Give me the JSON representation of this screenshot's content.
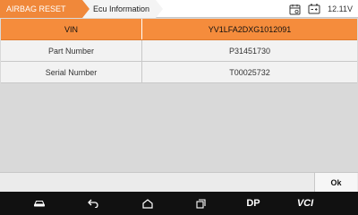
{
  "breadcrumb": {
    "items": [
      "AIRBAG RESET",
      "Ecu Information"
    ]
  },
  "status": {
    "voltage": "12.11V"
  },
  "table": {
    "header": {
      "key": "VIN",
      "value": "YV1LFA2DXG1012091"
    },
    "rows": [
      {
        "key": "Part Number",
        "value": "P31451730"
      },
      {
        "key": "Serial Number",
        "value": "T00025732"
      }
    ]
  },
  "footer": {
    "ok_label": "Ok"
  },
  "navbar": {
    "dp_label": "DP",
    "vci_label": "VCI"
  },
  "colors": {
    "accent": "#f58c3c",
    "navbar": "#111111"
  }
}
